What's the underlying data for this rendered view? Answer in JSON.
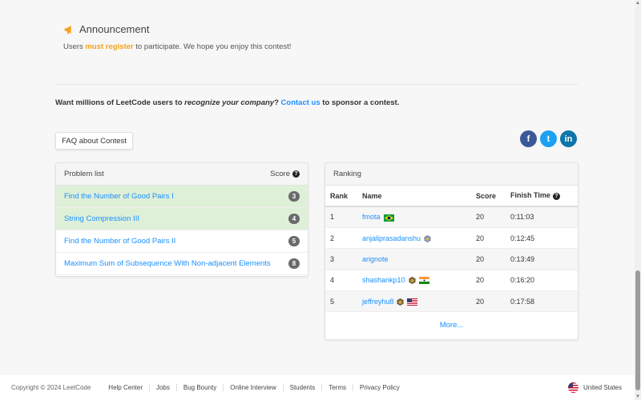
{
  "announcement": {
    "title": "Announcement",
    "text_pre": "Users ",
    "text_highlight": "must register",
    "text_post": " to participate. We hope you enjoy this contest!"
  },
  "sponsor": {
    "pre": "Want millions of LeetCode users to ",
    "em": "recognize your company",
    "mid": "? ",
    "link": "Contact us",
    "post": " to sponsor a contest."
  },
  "faq_button": "FAQ about Contest",
  "social": [
    {
      "icon": "facebook-icon",
      "glyph": "f",
      "color": "#3b5998"
    },
    {
      "icon": "twitter-icon",
      "glyph": "t",
      "color": "#1da1f2"
    },
    {
      "icon": "linkedin-icon",
      "glyph": "in",
      "color": "#0e76a8"
    }
  ],
  "problem_list": {
    "header": "Problem list",
    "score_label": "Score",
    "problems": [
      {
        "title": "Find the Number of Good Pairs I",
        "score": "3",
        "solved": true
      },
      {
        "title": "String Compression III",
        "score": "4",
        "solved": true
      },
      {
        "title": "Find the Number of Good Pairs II",
        "score": "5",
        "solved": false
      },
      {
        "title": "Maximum Sum of Subsequence With Non-adjacent Elements",
        "score": "8",
        "solved": false
      }
    ]
  },
  "ranking": {
    "header": "Ranking",
    "columns": [
      "Rank",
      "Name",
      "Score",
      "Finish Time"
    ],
    "rows": [
      {
        "rank": "1",
        "name": "fmota",
        "badge": false,
        "flag": "brazil",
        "score": "20",
        "time": "0:11:03"
      },
      {
        "rank": "2",
        "name": "anjaliprasadanshu",
        "badge": true,
        "flag": "",
        "score": "20",
        "time": "0:12:45"
      },
      {
        "rank": "3",
        "name": "arignote",
        "badge": false,
        "flag": "",
        "score": "20",
        "time": "0:13:49"
      },
      {
        "rank": "4",
        "name": "shashankp10",
        "badge": true,
        "flag": "india",
        "score": "20",
        "time": "0:16:20"
      },
      {
        "rank": "5",
        "name": "jeffreyhu8",
        "badge": true,
        "flag": "usa",
        "score": "20",
        "time": "0:17:58"
      }
    ],
    "more": "More..."
  },
  "footer": {
    "copyright": "Copyright © 2024 LeetCode",
    "links": [
      "Help Center",
      "Jobs",
      "Bug Bounty",
      "Online Interview",
      "Students",
      "Terms",
      "Privacy Policy"
    ],
    "country": "United States"
  }
}
